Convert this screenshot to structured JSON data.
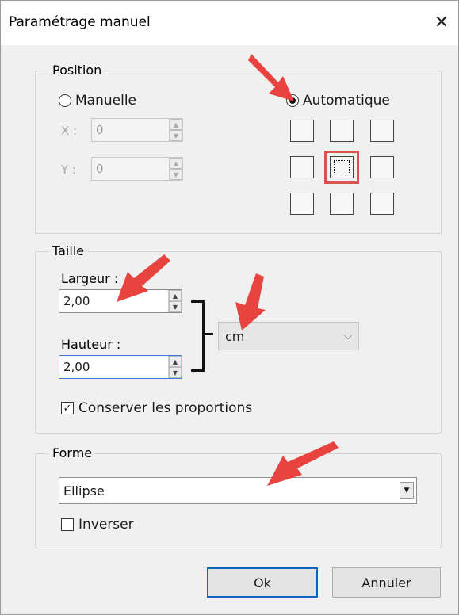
{
  "window": {
    "title": "Paramétrage manuel",
    "close_icon": "close-icon",
    "close_glyph": "✕"
  },
  "position": {
    "label": "Position",
    "manual_label": "Manuelle",
    "auto_label": "Automatique",
    "selected_mode": "Automatique",
    "x_label": "X :",
    "x_value": "0",
    "y_label": "Y :",
    "y_value": "0",
    "anchor_grid": {
      "rows": 3,
      "cols": 3,
      "selected": "middle-center"
    }
  },
  "size": {
    "label": "Taille",
    "width_label": "Largeur :",
    "width_value": "2,00",
    "height_label": "Hauteur :",
    "height_value": "2,00",
    "unit": "cm",
    "keep_proportions_label": "Conserver les proportions",
    "keep_proportions": true
  },
  "shape": {
    "label": "Forme",
    "value": "Ellipse",
    "invert_label": "Inverser",
    "invert": false
  },
  "buttons": {
    "ok": "Ok",
    "cancel": "Annuler"
  },
  "annotations": {
    "arrow_color": "#e8433f",
    "highlight_color": "#d9534f"
  },
  "glyphs": {
    "up": "▲",
    "down": "▼",
    "chevron": "⌵",
    "check": "✓"
  }
}
